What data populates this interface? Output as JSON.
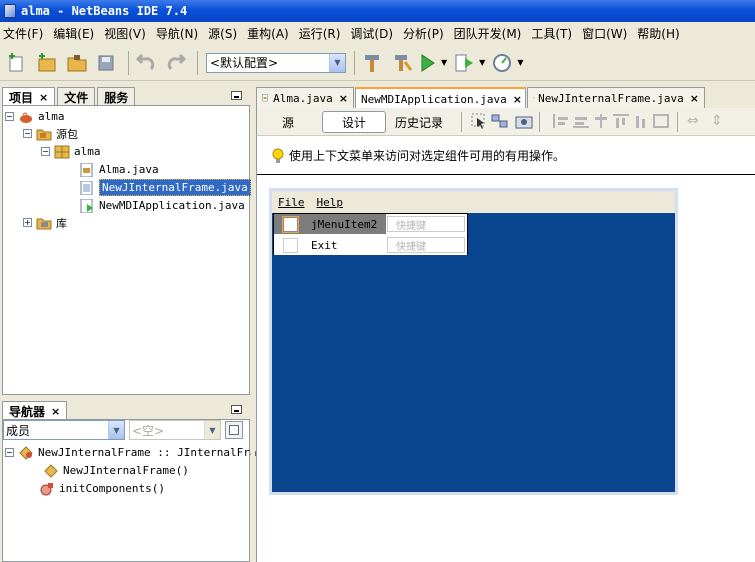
{
  "window": {
    "title": "alma - NetBeans IDE 7.4"
  },
  "menubar": [
    "文件(F)",
    "编辑(E)",
    "视图(V)",
    "导航(N)",
    "源(S)",
    "重构(A)",
    "运行(R)",
    "调试(D)",
    "分析(P)",
    "团队开发(M)",
    "工具(T)",
    "窗口(W)",
    "帮助(H)"
  ],
  "toolbar": {
    "config_value": "<默认配置>"
  },
  "projects_panel": {
    "tabs": [
      "项目",
      "文件",
      "服务"
    ],
    "tree": [
      {
        "label": "alma",
        "level": 0
      },
      {
        "label": "源包",
        "level": 1
      },
      {
        "label": "alma",
        "level": 2
      },
      {
        "label": "Alma.java",
        "level": 3
      },
      {
        "label": "NewJInternalFrame.java",
        "level": 3,
        "selected": true
      },
      {
        "label": "NewMDIApplication.java",
        "level": 3
      },
      {
        "label": "库",
        "level": 1
      }
    ]
  },
  "navigator_panel": {
    "title": "导航器",
    "filter_value": "成员",
    "filter2_value": "<空>",
    "tree": [
      {
        "label": "NewJInternalFrame :: JInternalFrame"
      },
      {
        "label": "NewJInternalFrame()"
      },
      {
        "label": "initComponents()"
      }
    ]
  },
  "editor": {
    "tabs": [
      {
        "label": "Alma.java",
        "active": false
      },
      {
        "label": "NewMDIApplication.java",
        "active": true
      },
      {
        "label": "NewJInternalFrame.java",
        "active": false
      }
    ],
    "view_buttons": [
      "源",
      "设计",
      "历史记录"
    ],
    "active_view": "设计",
    "hint": "使用上下文菜单来访问对选定组件可用的有用操作。",
    "form_menubar": [
      "File",
      "Help"
    ],
    "menu_items": [
      {
        "label": "jMenuItem2",
        "shortcut": "快捷键",
        "selected": true
      },
      {
        "label": "Exit",
        "shortcut": "快捷键",
        "selected": false
      }
    ]
  },
  "colors": {
    "desktop": "#0a468f",
    "title_blue": "#0a51d9",
    "selection": "#316ac5"
  }
}
